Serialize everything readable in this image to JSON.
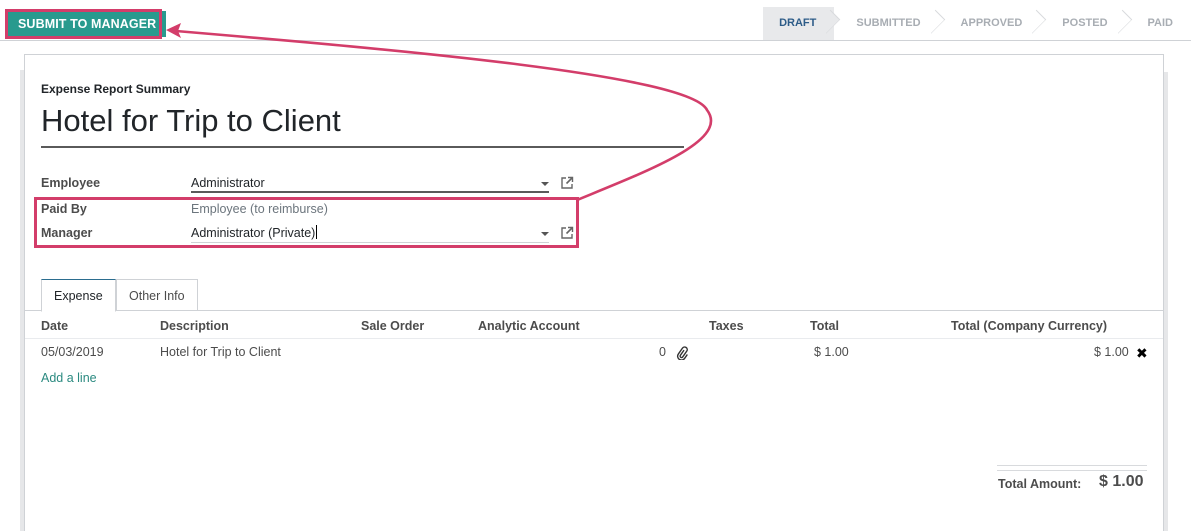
{
  "header": {
    "submit_button": "SUBMIT TO MANAGER",
    "stages": [
      {
        "label": "DRAFT",
        "active": true
      },
      {
        "label": "SUBMITTED",
        "active": false
      },
      {
        "label": "APPROVED",
        "active": false
      },
      {
        "label": "POSTED",
        "active": false
      },
      {
        "label": "PAID",
        "active": false
      }
    ]
  },
  "form": {
    "summary_label": "Expense Report Summary",
    "title": "Hotel for Trip to Client",
    "fields": {
      "employee": {
        "label": "Employee",
        "value": "Administrator"
      },
      "paid_by": {
        "label": "Paid By",
        "value": "Employee (to reimburse)"
      },
      "manager": {
        "label": "Manager",
        "value": "Administrator (Private)"
      }
    }
  },
  "tabs": [
    {
      "label": "Expense",
      "active": true
    },
    {
      "label": "Other Info",
      "active": false
    }
  ],
  "table": {
    "columns": [
      "Date",
      "Description",
      "Sale Order",
      "Analytic Account",
      "Taxes",
      "Total",
      "Total (Company Currency)"
    ],
    "rows": [
      {
        "date": "05/03/2019",
        "description": "Hotel for Trip to Client",
        "sale_order": "",
        "analytic_account": "",
        "attachments": "0",
        "taxes": "",
        "total": "$ 1.00",
        "total_company": "$ 1.00"
      }
    ],
    "add_line": "Add a line"
  },
  "totals": {
    "label": "Total Amount:",
    "value": "$ 1.00"
  },
  "icons": {
    "dropdown": "caret-down-icon",
    "external_link": "external-link-icon",
    "attachment": "paperclip-icon",
    "delete": "close-icon"
  },
  "colors": {
    "primary": "#289a8e",
    "annotation": "#d33d6a",
    "active_stage_text": "#2d5c88",
    "link": "#2b8a80"
  }
}
